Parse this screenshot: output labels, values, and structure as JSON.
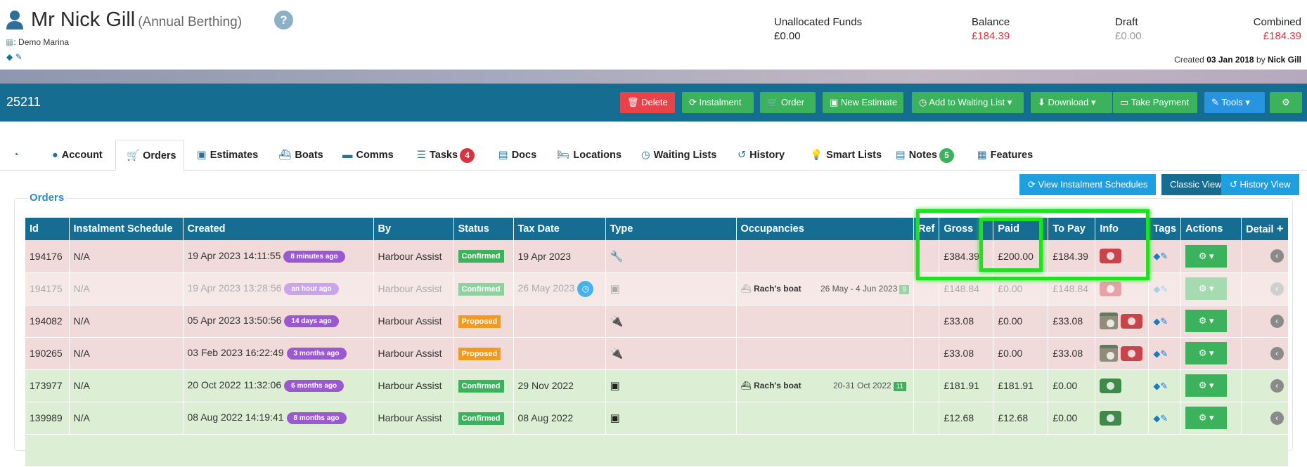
{
  "customer": {
    "name": "Mr Nick Gill",
    "type": "(Annual Berthing)",
    "marina_prefix": ":",
    "marina": "Demo Marina"
  },
  "finance": {
    "unallocated_label": "Unallocated Funds",
    "unallocated_value": "£0.00",
    "balance_label": "Balance",
    "balance_value": "£184.39",
    "draft_label": "Draft",
    "draft_value": "£0.00",
    "combined_label": "Combined",
    "combined_value": "£184.39"
  },
  "created": {
    "prefix": "Created",
    "date": "03 Jan 2018",
    "by": "by",
    "user": "Nick Gill"
  },
  "toolbar": {
    "account_ref": "25211",
    "delete": "Delete",
    "instalment": "Instalment",
    "order": "Order",
    "new_estimate": "New Estimate",
    "waiting_list": "Add to Waiting List",
    "download": "Download",
    "take_payment": "Take Payment",
    "tools": "Tools"
  },
  "tabs": {
    "account": "Account",
    "orders": "Orders",
    "estimates": "Estimates",
    "boats": "Boats",
    "comms": "Comms",
    "tasks": "Tasks",
    "tasks_count": "4",
    "docs": "Docs",
    "locations": "Locations",
    "waiting_lists": "Waiting Lists",
    "history": "History",
    "smart_lists": "Smart Lists",
    "notes": "Notes",
    "notes_count": "5",
    "features": "Features"
  },
  "views": {
    "instalment_schedules": "View Instalment Schedules",
    "classic": "Classic View",
    "history": "History View"
  },
  "orders_panel_title": "Orders",
  "columns": {
    "id": "Id",
    "instalment": "Instalment Schedule",
    "created": "Created",
    "by": "By",
    "status": "Status",
    "tax_date": "Tax Date",
    "type": "Type",
    "occupancies": "Occupancies",
    "ref": "Ref",
    "gross": "Gross",
    "paid": "Paid",
    "to_pay": "To Pay",
    "info": "Info",
    "tags": "Tags",
    "actions": "Actions",
    "detail": "Detail",
    "add": "+"
  },
  "rows": [
    {
      "id": "194176",
      "inst": "N/A",
      "created": "19 Apr 2023 14:11:55",
      "ago": "8 minutes ago",
      "by": "Harbour Assist",
      "status": "Confirmed",
      "tax": "19 Apr 2023",
      "gross": "£384.39",
      "paid": "£200.00",
      "topay": "£184.39",
      "boat": "",
      "dates": "",
      "nights": ""
    },
    {
      "id": "194175",
      "inst": "N/A",
      "created": "19 Apr 2023 13:28:56",
      "ago": "an hour ago",
      "by": "Harbour Assist",
      "status": "Confirmed",
      "tax": "26 May 2023",
      "gross": "£148.84",
      "paid": "£0.00",
      "topay": "£148.84",
      "boat": "Rach's boat",
      "dates": "26 May - 4 Jun 2023",
      "nights": "9"
    },
    {
      "id": "194082",
      "inst": "N/A",
      "created": "05 Apr 2023 13:50:56",
      "ago": "14 days ago",
      "by": "Harbour Assist",
      "status": "Proposed",
      "tax": "",
      "gross": "£33.08",
      "paid": "£0.00",
      "topay": "£33.08",
      "boat": "",
      "dates": "",
      "nights": ""
    },
    {
      "id": "190265",
      "inst": "N/A",
      "created": "03 Feb 2023 16:22:49",
      "ago": "3 months ago",
      "by": "Harbour Assist",
      "status": "Proposed",
      "tax": "",
      "gross": "£33.08",
      "paid": "£0.00",
      "topay": "£33.08",
      "boat": "",
      "dates": "",
      "nights": ""
    },
    {
      "id": "173977",
      "inst": "N/A",
      "created": "20 Oct 2022 11:32:06",
      "ago": "6 months ago",
      "by": "Harbour Assist",
      "status": "Confirmed",
      "tax": "29 Nov 2022",
      "gross": "£181.91",
      "paid": "£181.91",
      "topay": "£0.00",
      "boat": "Rach's boat",
      "dates": "20-31 Oct 2022",
      "nights": "11"
    },
    {
      "id": "139989",
      "inst": "N/A",
      "created": "08 Aug 2022 14:19:41",
      "ago": "8 months ago",
      "by": "Harbour Assist",
      "status": "Confirmed",
      "tax": "08 Aug 2022",
      "gross": "£12.68",
      "paid": "£12.68",
      "topay": "£0.00",
      "boat": "",
      "dates": "",
      "nights": ""
    }
  ],
  "icons": {
    "person": "person-icon",
    "help": "question-icon",
    "marina": "building-icon",
    "tag": "tag-icon",
    "edit": "edit-icon",
    "wrench": "wrench-icon",
    "briefcase": "briefcase-icon",
    "plug": "plug-icon",
    "boat": "boat-icon",
    "money": "money-icon",
    "cogs": "cogs-icon",
    "chevron": "chevron-left-icon"
  },
  "colors": {
    "primary": "#156e92",
    "green": "#3bb25b",
    "red": "#e8424a",
    "blue": "#2894e0",
    "highlight": "#20e020"
  }
}
